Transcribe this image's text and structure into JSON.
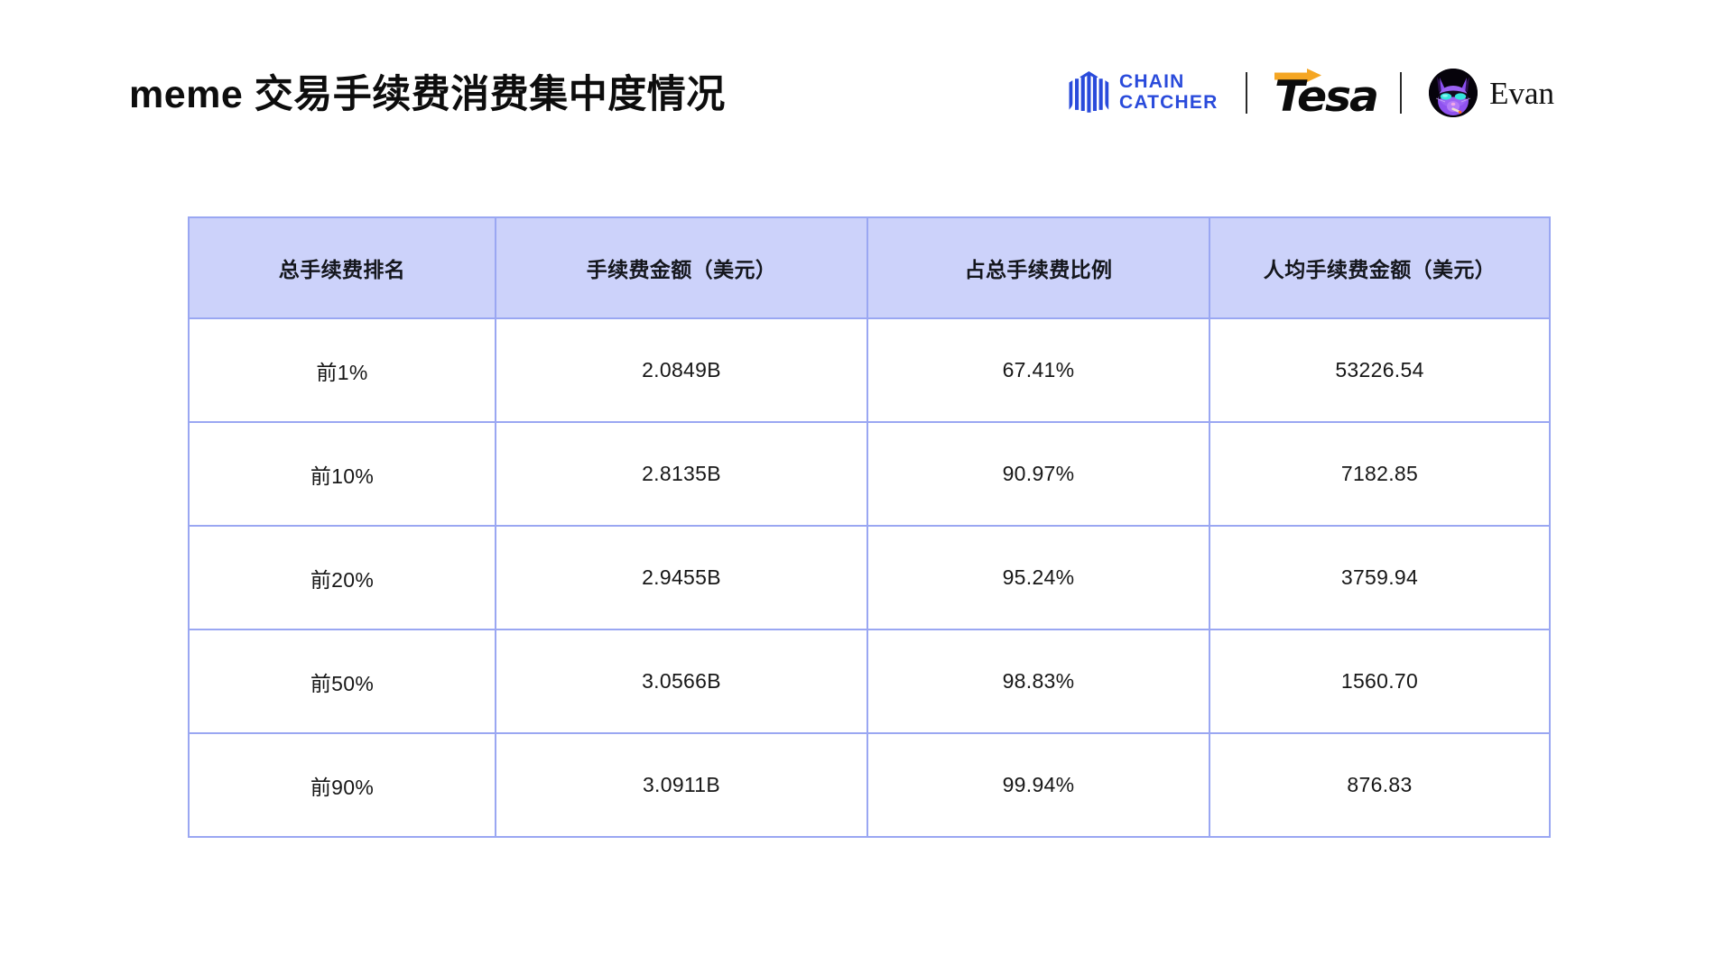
{
  "header": {
    "title": "meme 交易手续费消费集中度情况",
    "brands": {
      "chaincatcher": {
        "name": "chaincatcher-logo",
        "line1": "CHAIN",
        "line2": "CATCHER",
        "color": "#2a4bdb"
      },
      "tesa": {
        "name": "tesa-logo",
        "wordmark": "Tesa",
        "arrow_color": "#f5a623",
        "text_color": "#0b0b0b"
      },
      "evan": {
        "name": "evan-profile",
        "display_name": "Evan",
        "avatar_alt": "purple cat avatar with teal sunglasses"
      },
      "divider_color": "#2b2b2b"
    }
  },
  "table": {
    "accent_border": "#9aa7f2",
    "header_fill": "#ccd2fa",
    "columns": [
      "总手续费排名",
      "手续费金额（美元）",
      "占总手续费比例",
      "人均手续费金额（美元）"
    ],
    "rows": [
      {
        "rank": "前1%",
        "amount": "2.0849B",
        "share": "67.41%",
        "per_capita": "53226.54"
      },
      {
        "rank": "前10%",
        "amount": "2.8135B",
        "share": "90.97%",
        "per_capita": "7182.85"
      },
      {
        "rank": "前20%",
        "amount": "2.9455B",
        "share": "95.24%",
        "per_capita": "3759.94"
      },
      {
        "rank": "前50%",
        "amount": "3.0566B",
        "share": "98.83%",
        "per_capita": "1560.70"
      },
      {
        "rank": "前90%",
        "amount": "3.0911B",
        "share": "99.94%",
        "per_capita": "876.83"
      }
    ]
  },
  "chart_data": {
    "type": "table",
    "title": "meme 交易手续费消费集中度情况",
    "columns": [
      "总手续费排名",
      "手续费金额（美元）",
      "占总手续费比例",
      "人均手续费金额（美元）"
    ],
    "categories": [
      "前1%",
      "前10%",
      "前20%",
      "前50%",
      "前90%"
    ],
    "series": [
      {
        "name": "手续费金额（美元）",
        "values": [
          2.0849,
          2.8135,
          2.9455,
          3.0566,
          3.0911
        ],
        "unit": "B"
      },
      {
        "name": "占总手续费比例",
        "values": [
          67.41,
          90.97,
          95.24,
          98.83,
          99.94
        ],
        "unit": "%"
      },
      {
        "name": "人均手续费金额（美元）",
        "values": [
          53226.54,
          7182.85,
          3759.94,
          1560.7,
          876.83
        ],
        "unit": "USD"
      }
    ]
  }
}
